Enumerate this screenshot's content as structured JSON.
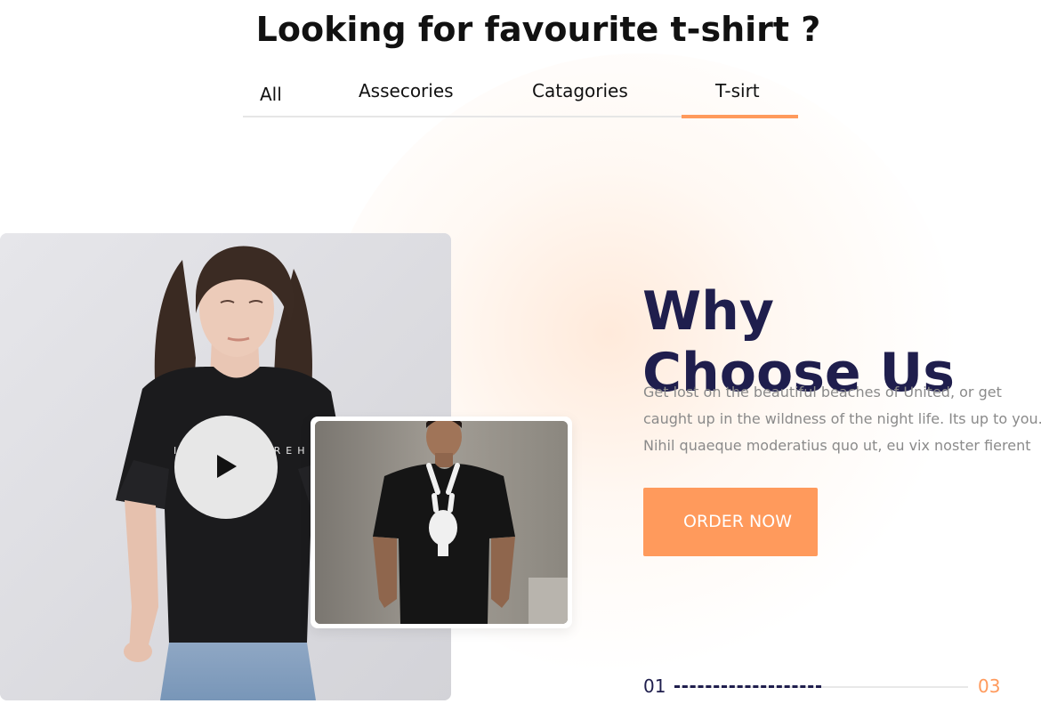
{
  "header": {
    "title": "Looking for favourite t-shirt ?"
  },
  "tabs": [
    {
      "label": "All",
      "active": false
    },
    {
      "label": "Assecories",
      "active": false
    },
    {
      "label": "Catagories",
      "active": false
    },
    {
      "label": "T-sirt",
      "active": true
    }
  ],
  "feature": {
    "title_line1": "Why",
    "title_line2": "Choose Us",
    "description": [
      "Get lost on the beautiful beaches of United, or get",
      "caught up in the wildness of the night life. Its up to you.",
      "Nihil quaeque moderatius quo ut, eu vix noster fierent"
    ],
    "cta_label": "ORDER NOW",
    "media": {
      "play_icon": "play-icon"
    }
  },
  "slider": {
    "current": "01",
    "total": "03",
    "progress": 0.5
  },
  "colors": {
    "accent": "#ff9a5c",
    "heading": "#1f1e4d",
    "body_text": "#8a8a8a",
    "tab_underline": "#ff9a5c"
  }
}
